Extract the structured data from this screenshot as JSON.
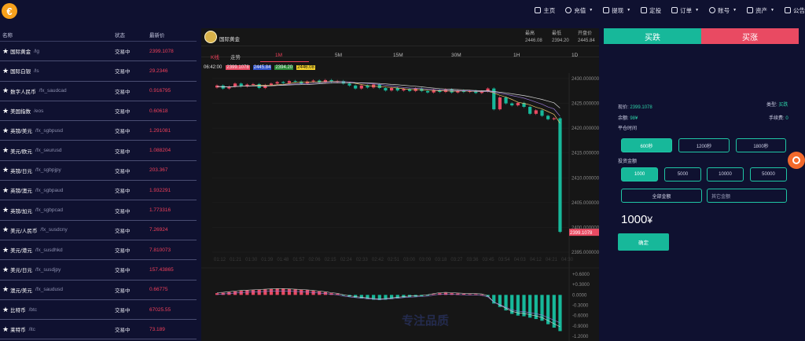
{
  "brand": {
    "logo_symbol": "€",
    "accent": "#f7a11c"
  },
  "nav": [
    {
      "label": "主页",
      "icon": "home-icon"
    },
    {
      "label": "充值",
      "icon": "deposit-icon",
      "caret": true
    },
    {
      "label": "提现",
      "icon": "withdraw-icon",
      "caret": true
    },
    {
      "label": "定投",
      "icon": "plan-icon"
    },
    {
      "label": "订单",
      "icon": "order-icon",
      "caret": true
    },
    {
      "label": "账号",
      "icon": "account-icon",
      "caret": true
    },
    {
      "label": "资产",
      "icon": "asset-icon",
      "caret": true
    },
    {
      "label": "公告",
      "icon": "notice-icon"
    }
  ],
  "market": {
    "headers": [
      "名称",
      "状态",
      "最新价"
    ],
    "rows": [
      {
        "name": "国际黄金",
        "code": "/lg",
        "status": "交易中",
        "price": "2399.1078"
      },
      {
        "name": "国际白银",
        "code": "/ls",
        "status": "交易中",
        "price": "29.2346"
      },
      {
        "name": "数字人民币",
        "code": "/fx_saudcad",
        "status": "交易中",
        "price": "0.916795"
      },
      {
        "name": "美国指数",
        "code": "/eos",
        "status": "交易中",
        "price": "0.60618"
      },
      {
        "name": "英镑/美元",
        "code": "/fx_sgbpusd",
        "status": "交易中",
        "price": "1.291081"
      },
      {
        "name": "美元/欧元",
        "code": "/fx_seurusd",
        "status": "交易中",
        "price": "1.088204"
      },
      {
        "name": "英镑/日元",
        "code": "/fx_sgbpjpy",
        "status": "交易中",
        "price": "203.367"
      },
      {
        "name": "英镑/澳元",
        "code": "/fx_sgbpaud",
        "status": "交易中",
        "price": "1.932291"
      },
      {
        "name": "英镑/加元",
        "code": "/fx_sgbpcad",
        "status": "交易中",
        "price": "1.773316"
      },
      {
        "name": "美元/人民币",
        "code": "/fx_susdcny",
        "status": "交易中",
        "price": "7.26924"
      },
      {
        "name": "美元/港元",
        "code": "/fx_susdhkd",
        "status": "交易中",
        "price": "7.810073"
      },
      {
        "name": "美元/日元",
        "code": "/fx_susdjpy",
        "status": "交易中",
        "price": "157.43865"
      },
      {
        "name": "澳元/美元",
        "code": "/fx_saudusd",
        "status": "交易中",
        "price": "0.66775"
      },
      {
        "name": "比特币",
        "code": "/btc",
        "status": "交易中",
        "price": "67025.55"
      },
      {
        "name": "莱特币",
        "code": "/ltc",
        "status": "交易中",
        "price": "73.189"
      }
    ]
  },
  "chart_header": {
    "title": "国际黄金",
    "high_label": "最高",
    "high_value": "2446.08",
    "low_label": "最低",
    "low_value": "2394.20",
    "open_label": "开盘价",
    "open_value": "2445.84"
  },
  "tabs": [
    {
      "label": "K线",
      "active": true
    },
    {
      "label": "走势",
      "active": false
    },
    {
      "label": "1M",
      "active": true
    },
    {
      "label": "5M",
      "active": false
    },
    {
      "label": "15M",
      "active": false
    },
    {
      "label": "30M",
      "active": false
    },
    {
      "label": "1H",
      "active": false
    },
    {
      "label": "1D",
      "active": false
    }
  ],
  "ohlc_legend": {
    "time": "06:42:00",
    "values": [
      "2399.1078",
      "2445.84",
      "2394.20",
      "2446.08"
    ],
    "colors": [
      "#e94a62",
      "#3355cc",
      "#2a8a38",
      "#f2d02b"
    ]
  },
  "chart_data": {
    "type": "candlestick",
    "y_ticks": [
      "2430.000000",
      "2425.000000",
      "2420.000000",
      "2415.000000",
      "2410.000000",
      "2405.000000",
      "2400.000000",
      "2395.000000"
    ],
    "ylim": [
      2395,
      2430
    ],
    "x_ticks": [
      "01:12",
      "01:21",
      "01:30",
      "01:39",
      "01:48",
      "01:57",
      "02:06",
      "02:15",
      "02:24",
      "02:33",
      "02:42",
      "02:51",
      "03:00",
      "03:09",
      "03:18",
      "03:27",
      "03:36",
      "03:45",
      "03:54",
      "04:03",
      "04:12",
      "04:21",
      "04:30"
    ],
    "last_price_label": "2399.1078",
    "candles": [
      [
        2428.2,
        2428.6
      ],
      [
        2428.6,
        2428.0
      ],
      [
        2428.0,
        2428.4
      ],
      [
        2428.4,
        2429.0
      ],
      [
        2429.0,
        2428.4
      ],
      [
        2428.4,
        2428.8
      ],
      [
        2428.8,
        2428.9
      ],
      [
        2428.9,
        2428.1
      ],
      [
        2428.1,
        2428.7
      ],
      [
        2428.7,
        2429.0
      ],
      [
        2429.0,
        2429.3
      ],
      [
        2429.3,
        2429.1
      ],
      [
        2429.1,
        2429.5
      ],
      [
        2429.5,
        2429.4
      ],
      [
        2429.4,
        2429.0
      ],
      [
        2429.0,
        2429.4
      ],
      [
        2429.4,
        2429.6
      ],
      [
        2429.6,
        2429.2
      ],
      [
        2429.2,
        2429.7
      ],
      [
        2429.7,
        2429.3
      ],
      [
        2429.3,
        2429.5
      ],
      [
        2429.5,
        2429.0
      ],
      [
        2429.0,
        2428.6
      ],
      [
        2428.6,
        2428.0
      ],
      [
        2428.0,
        2428.6
      ],
      [
        2428.6,
        2428.2
      ],
      [
        2428.2,
        2428.8
      ],
      [
        2428.8,
        2428.1
      ],
      [
        2428.1,
        2427.6
      ],
      [
        2427.6,
        2428.1
      ],
      [
        2428.1,
        2427.6
      ],
      [
        2427.6,
        2427.9
      ],
      [
        2427.9,
        2427.5
      ],
      [
        2427.5,
        2428.0
      ],
      [
        2428.0,
        2427.5
      ],
      [
        2427.5,
        2427.2
      ],
      [
        2427.2,
        2427.7
      ],
      [
        2427.7,
        2427.3
      ],
      [
        2427.3,
        2427.8
      ],
      [
        2427.8,
        2427.2
      ],
      [
        2427.2,
        2427.6
      ],
      [
        2427.6,
        2427.3
      ],
      [
        2427.3,
        2427.5
      ],
      [
        2427.5,
        2427.1
      ],
      [
        2427.1,
        2427.4
      ],
      [
        2427.4,
        2428.0
      ],
      [
        2428.0,
        2423.8
      ],
      [
        2423.8,
        2426.2
      ],
      [
        2426.2,
        2425.0
      ],
      [
        2425.0,
        2424.6
      ],
      [
        2424.6,
        2425.1
      ],
      [
        2425.1,
        2424.3
      ],
      [
        2424.3,
        2422.9
      ],
      [
        2422.9,
        2423.6
      ],
      [
        2423.6,
        2422.5
      ],
      [
        2422.5,
        2421.8
      ],
      [
        2421.8,
        2422.0
      ],
      [
        2422.0,
        2399.1
      ]
    ],
    "macd_ticks": [
      "+0.6000",
      "+0.3000",
      "0.0000",
      "-0.3000",
      "-0.6000",
      "-0.9000",
      "-1.2000"
    ],
    "macd_ylim": [
      -1.2,
      0.6
    ],
    "macd": [
      0.05,
      0.06,
      0.08,
      0.1,
      0.12,
      0.13,
      0.14,
      0.15,
      0.16,
      0.17,
      0.18,
      0.18,
      0.17,
      0.16,
      0.15,
      0.14,
      0.12,
      0.1,
      0.08,
      0.05,
      0.03,
      -0.02,
      -0.05,
      -0.08,
      -0.1,
      -0.12,
      -0.14,
      -0.15,
      -0.14,
      -0.12,
      -0.1,
      -0.08,
      -0.06,
      -0.05,
      -0.04,
      -0.02,
      0.02,
      0.05,
      0.06,
      0.05,
      0.04,
      0.03,
      0.02,
      0.02,
      0.01,
      -0.05,
      -0.25,
      -0.35,
      -0.45,
      -0.55,
      -0.6,
      -0.62,
      -0.66,
      -0.7,
      -0.75,
      -0.85,
      -0.95,
      -1.05
    ],
    "watermark": "专注品质"
  },
  "trade": {
    "buy_label": "买跌",
    "sell_label": "买涨",
    "buy_color": "#17b89a",
    "sell_color": "#e94a62",
    "current_price_label": "现价:",
    "current_price": "2399.1078",
    "type_label": "类型:",
    "type_value": "买跌",
    "balance_label": "余额:",
    "balance_value": "98¥",
    "fee_label": "手续费:",
    "fee_value": "0",
    "close_time_label": "平仓时间",
    "durations": [
      "600秒",
      "1200秒",
      "1800秒"
    ],
    "selected_duration": "600秒",
    "amount_label": "投资金额",
    "amounts": [
      "1000",
      "5000",
      "10000",
      "50000"
    ],
    "selected_amount": "1000",
    "all_label": "全部金额",
    "other_placeholder": "其它金额",
    "display_amount": "1000",
    "currency": "¥",
    "confirm_label": "确定"
  }
}
